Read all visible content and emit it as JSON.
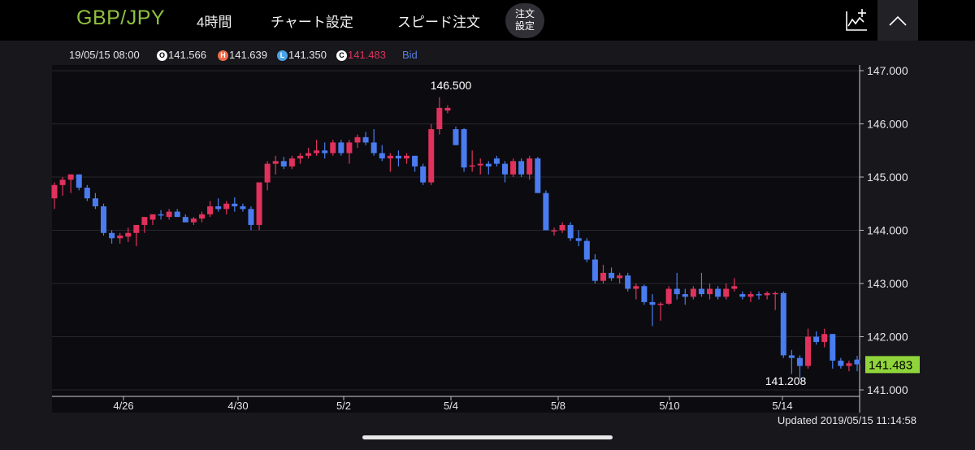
{
  "header": {
    "pair": "GBP/JPY",
    "timeframe": "4時間",
    "chart_settings": "チャート設定",
    "speed_order": "スピード注文",
    "order_settings_line1": "注文",
    "order_settings_line2": "設定"
  },
  "ohlc": {
    "datetime": "19/05/15 08:00",
    "open_badge": "O",
    "open": "141.566",
    "high_badge": "H",
    "high": "141.639",
    "low_badge": "L",
    "low": "141.350",
    "close_badge": "C",
    "close": "141.483",
    "price_type": "Bid"
  },
  "colors": {
    "up": "#e0325d",
    "down": "#4a7cf0",
    "pair": "#8fbf3f",
    "current_price_bg": "#8fd43a",
    "open_badge": "#ffffff",
    "high_badge": "#f06a4a",
    "low_badge": "#4aa3e8",
    "close_badge": "#ffffff",
    "close_text": "#e0325d",
    "bid_text": "#5a7fe0"
  },
  "icons": [
    "chart-add-icon",
    "chevron-up-icon"
  ],
  "chart_data": {
    "type": "candlestick",
    "ylim": [
      140.85,
      147.1
    ],
    "y_ticks": [
      "147.000",
      "146.000",
      "145.000",
      "144.000",
      "143.000",
      "142.000",
      "141.000"
    ],
    "x_tick_labels": [
      "4/26",
      "4/30",
      "5/2",
      "5/4",
      "5/8",
      "5/10",
      "5/14"
    ],
    "max_label": "146.500",
    "min_label": "141.208",
    "current_price": "141.483",
    "candles": [
      [
        144.6,
        144.9,
        144.4,
        144.85
      ],
      [
        144.85,
        145.0,
        144.65,
        144.95
      ],
      [
        144.95,
        145.05,
        144.7,
        145.05
      ],
      [
        145.05,
        145.05,
        144.75,
        144.8
      ],
      [
        144.8,
        144.85,
        144.55,
        144.6
      ],
      [
        144.6,
        144.7,
        144.4,
        144.45
      ],
      [
        144.45,
        144.5,
        143.9,
        143.95
      ],
      [
        143.95,
        144.0,
        143.75,
        143.85
      ],
      [
        143.85,
        143.95,
        143.75,
        143.9
      ],
      [
        143.88,
        144.05,
        143.78,
        143.95
      ],
      [
        143.95,
        144.1,
        143.7,
        144.1
      ],
      [
        144.1,
        144.25,
        143.95,
        144.25
      ],
      [
        144.2,
        144.3,
        144.1,
        144.3
      ],
      [
        144.3,
        144.38,
        144.2,
        144.28
      ],
      [
        144.25,
        144.4,
        144.2,
        144.35
      ],
      [
        144.35,
        144.4,
        144.25,
        144.25
      ],
      [
        144.25,
        144.3,
        144.15,
        144.15
      ],
      [
        144.15,
        144.25,
        144.1,
        144.22
      ],
      [
        144.22,
        144.35,
        144.15,
        144.3
      ],
      [
        144.3,
        144.55,
        144.25,
        144.45
      ],
      [
        144.45,
        144.6,
        144.35,
        144.4
      ],
      [
        144.4,
        144.55,
        144.3,
        144.5
      ],
      [
        144.5,
        144.62,
        144.35,
        144.45
      ],
      [
        144.45,
        144.5,
        144.35,
        144.4
      ],
      [
        144.4,
        144.45,
        144.0,
        144.1
      ],
      [
        144.1,
        144.9,
        144.0,
        144.9
      ],
      [
        144.9,
        145.3,
        144.75,
        145.25
      ],
      [
        145.25,
        145.4,
        145.05,
        145.3
      ],
      [
        145.3,
        145.38,
        145.15,
        145.2
      ],
      [
        145.2,
        145.4,
        145.15,
        145.35
      ],
      [
        145.35,
        145.45,
        145.25,
        145.4
      ],
      [
        145.4,
        145.55,
        145.35,
        145.45
      ],
      [
        145.45,
        145.7,
        145.4,
        145.5
      ],
      [
        145.5,
        145.65,
        145.35,
        145.45
      ],
      [
        145.45,
        145.7,
        145.4,
        145.65
      ],
      [
        145.65,
        145.7,
        145.4,
        145.45
      ],
      [
        145.45,
        145.7,
        145.25,
        145.65
      ],
      [
        145.65,
        145.8,
        145.55,
        145.75
      ],
      [
        145.75,
        145.85,
        145.6,
        145.65
      ],
      [
        145.65,
        145.9,
        145.4,
        145.45
      ],
      [
        145.45,
        145.6,
        145.3,
        145.35
      ],
      [
        145.35,
        145.45,
        145.1,
        145.4
      ],
      [
        145.4,
        145.5,
        145.2,
        145.35
      ],
      [
        145.35,
        145.45,
        145.25,
        145.4
      ],
      [
        145.4,
        145.4,
        145.1,
        145.2
      ],
      [
        145.2,
        145.25,
        144.85,
        144.9
      ],
      [
        144.9,
        146.0,
        144.85,
        145.9
      ],
      [
        145.9,
        146.5,
        145.8,
        146.3
      ],
      [
        146.25,
        146.35,
        146.2,
        146.3
      ],
      [
        145.9,
        145.95,
        145.6,
        145.6
      ],
      [
        145.9,
        145.92,
        145.1,
        145.18
      ],
      [
        145.2,
        145.5,
        145.1,
        145.22
      ],
      [
        145.22,
        145.35,
        145.05,
        145.25
      ],
      [
        145.25,
        145.3,
        145.05,
        145.2
      ],
      [
        145.35,
        145.4,
        145.2,
        145.25
      ],
      [
        145.25,
        145.3,
        144.9,
        145.05
      ],
      [
        145.05,
        145.35,
        145.0,
        145.3
      ],
      [
        145.3,
        145.35,
        145.0,
        145.05
      ],
      [
        145.05,
        145.4,
        144.95,
        145.35
      ],
      [
        145.35,
        145.38,
        144.7,
        144.7
      ],
      [
        144.7,
        144.75,
        144.0,
        144.0
      ],
      [
        144.0,
        144.05,
        143.9,
        144.0
      ],
      [
        144.0,
        144.15,
        143.95,
        144.1
      ],
      [
        144.1,
        144.15,
        143.8,
        143.85
      ],
      [
        143.85,
        144.0,
        143.7,
        143.8
      ],
      [
        143.8,
        143.85,
        143.4,
        143.45
      ],
      [
        143.45,
        143.55,
        143.0,
        143.05
      ],
      [
        143.05,
        143.35,
        143.0,
        143.2
      ],
      [
        143.2,
        143.3,
        143.05,
        143.1
      ],
      [
        143.1,
        143.2,
        143.0,
        143.15
      ],
      [
        143.15,
        143.2,
        142.85,
        142.9
      ],
      [
        142.9,
        143.0,
        142.7,
        142.95
      ],
      [
        142.95,
        142.98,
        142.6,
        142.65
      ],
      [
        142.65,
        142.8,
        142.2,
        142.6
      ],
      [
        142.6,
        142.65,
        142.3,
        142.62
      ],
      [
        142.62,
        142.95,
        142.6,
        142.9
      ],
      [
        142.9,
        143.2,
        142.7,
        142.8
      ],
      [
        142.8,
        142.9,
        142.6,
        142.75
      ],
      [
        142.75,
        142.95,
        142.7,
        142.9
      ],
      [
        142.9,
        143.2,
        142.75,
        142.8
      ],
      [
        142.8,
        143.0,
        142.7,
        142.9
      ],
      [
        142.9,
        142.95,
        142.7,
        142.75
      ],
      [
        142.75,
        143.0,
        142.7,
        142.9
      ],
      [
        142.9,
        143.1,
        142.85,
        142.95
      ],
      [
        142.8,
        142.85,
        142.7,
        142.75
      ],
      [
        142.75,
        142.85,
        142.65,
        142.8
      ],
      [
        142.8,
        142.85,
        142.7,
        142.78
      ],
      [
        142.78,
        142.85,
        142.7,
        142.82
      ],
      [
        142.82,
        142.85,
        142.5,
        142.82
      ],
      [
        142.82,
        142.85,
        141.6,
        141.65
      ],
      [
        141.65,
        141.75,
        141.3,
        141.6
      ],
      [
        141.6,
        141.65,
        141.21,
        141.45
      ],
      [
        141.45,
        142.15,
        141.4,
        142.0
      ],
      [
        142.0,
        142.1,
        141.85,
        141.9
      ],
      [
        141.9,
        142.15,
        141.8,
        142.05
      ],
      [
        142.05,
        142.05,
        141.4,
        141.55
      ],
      [
        141.55,
        141.6,
        141.4,
        141.45
      ],
      [
        141.45,
        141.55,
        141.35,
        141.5
      ],
      [
        141.57,
        141.64,
        141.35,
        141.48
      ]
    ]
  },
  "footer": {
    "updated_label": "Updated",
    "updated_time": "2019/05/15 11:14:58"
  }
}
